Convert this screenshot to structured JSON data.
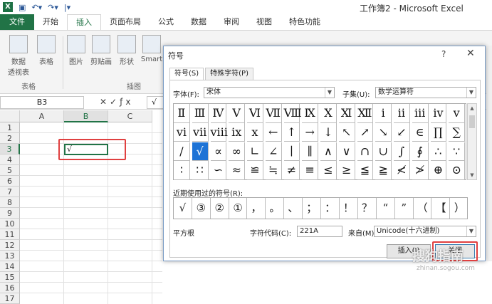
{
  "window": {
    "title": "工作簿2 - Microsoft Excel",
    "app_logo": "X"
  },
  "tabs": [
    "文件",
    "开始",
    "插入",
    "页面布局",
    "公式",
    "数据",
    "审阅",
    "视图",
    "特色功能"
  ],
  "ribbon": {
    "buttons": [
      "数据\n透视表",
      "表格",
      "图片",
      "剪贴画",
      "形状",
      "Smart"
    ],
    "pivot_dropdown": "透视表 ▾",
    "groups": [
      "表格",
      "插图"
    ]
  },
  "formula_bar": {
    "name_box": "B3",
    "formula_value": "√"
  },
  "sheet": {
    "columns": [
      "A",
      "B",
      "C"
    ],
    "rows": [
      "1",
      "2",
      "3",
      "4",
      "5",
      "6",
      "7",
      "8",
      "9",
      "10",
      "11",
      "12",
      "13",
      "14",
      "15",
      "16",
      "17"
    ],
    "selected_col": "B",
    "selected_row": "3",
    "b3_value": "√"
  },
  "dialog": {
    "title": "符号",
    "help": "?",
    "close": "✕",
    "tab_symbols": "符号(S)",
    "tab_special": "特殊字符(P)",
    "font_label": "字体(F):",
    "font_value": "宋体",
    "subset_label": "子集(U):",
    "subset_value": "数学运算符",
    "symbols": [
      "Ⅱ",
      "Ⅲ",
      "Ⅳ",
      "Ⅴ",
      "Ⅵ",
      "Ⅶ",
      "Ⅷ",
      "Ⅸ",
      "Ⅹ",
      "Ⅺ",
      "Ⅻ",
      "ⅰ",
      "ⅱ",
      "ⅲ",
      "ⅳ",
      "ⅴ",
      "ⅵ",
      "ⅶ",
      "ⅷ",
      "ⅸ",
      "ⅹ",
      "←",
      "↑",
      "→",
      "↓",
      "↖",
      "↗",
      "↘",
      "↙",
      "∈",
      "∏",
      "∑",
      "∕",
      "√",
      "∝",
      "∞",
      "∟",
      "∠",
      "∣",
      "∥",
      "∧",
      "∨",
      "∩",
      "∪",
      "∫",
      "∮",
      "∴",
      "∵",
      "∶",
      "∷",
      "∽",
      "≈",
      "≌",
      "≒",
      "≠",
      "≡",
      "≤",
      "≥",
      "≦",
      "≧",
      "≮",
      "≯",
      "⊕",
      "⊙"
    ],
    "selected_symbol": "√",
    "recent_label": "近期使用过的符号(R):",
    "recent": [
      "√",
      "③",
      "②",
      "①",
      "，",
      "。",
      "、",
      "；",
      "：",
      "！",
      "？",
      "“",
      "”",
      "（",
      "【",
      "）"
    ],
    "char_name": "平方根",
    "code_label": "字符代码(C):",
    "code_value": "221A",
    "from_label": "来自(M):",
    "from_value": "Unicode(十六进制)",
    "insert_button": "插入(I)",
    "close_button": "关闭"
  },
  "watermark": {
    "main": "搜狗指南",
    "sub": "zhinan.sogou.com"
  },
  "accent": "#217346",
  "highlight": "#e04040"
}
